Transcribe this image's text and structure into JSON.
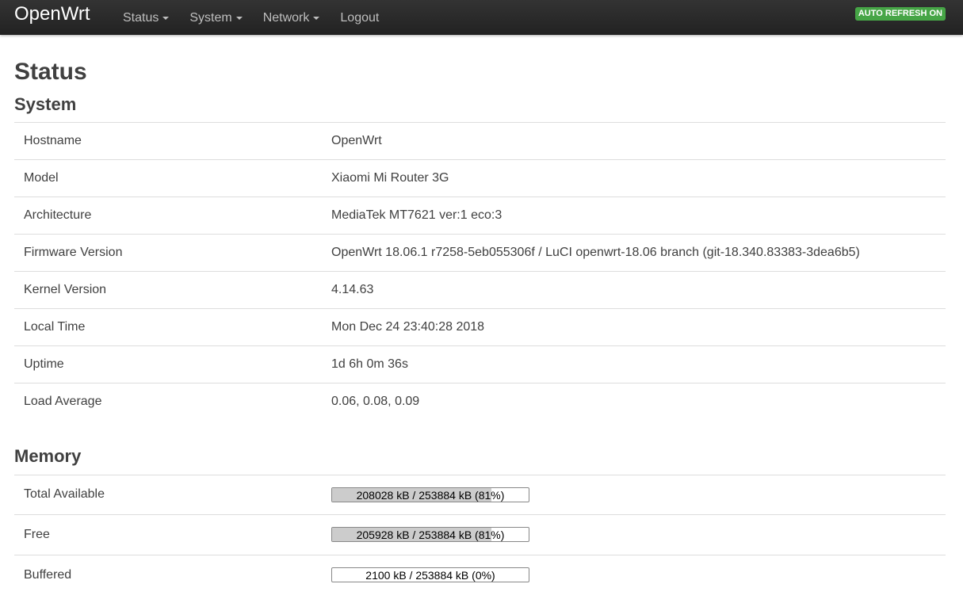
{
  "navbar": {
    "brand": "OpenWrt",
    "items": [
      {
        "label": "Status",
        "dropdown": true
      },
      {
        "label": "System",
        "dropdown": true
      },
      {
        "label": "Network",
        "dropdown": true
      },
      {
        "label": "Logout",
        "dropdown": false
      }
    ],
    "auto_refresh": "AUTO REFRESH ON"
  },
  "page": {
    "title": "Status"
  },
  "system": {
    "heading": "System",
    "rows": [
      {
        "label": "Hostname",
        "value": "OpenWrt"
      },
      {
        "label": "Model",
        "value": "Xiaomi Mi Router 3G"
      },
      {
        "label": "Architecture",
        "value": "MediaTek MT7621 ver:1 eco:3"
      },
      {
        "label": "Firmware Version",
        "value": "OpenWrt 18.06.1 r7258-5eb055306f / LuCI openwrt-18.06 branch (git-18.340.83383-3dea6b5)"
      },
      {
        "label": "Kernel Version",
        "value": "4.14.63"
      },
      {
        "label": "Local Time",
        "value": "Mon Dec 24 23:40:28 2018"
      },
      {
        "label": "Uptime",
        "value": "1d 6h 0m 36s"
      },
      {
        "label": "Load Average",
        "value": "0.06, 0.08, 0.09"
      }
    ]
  },
  "memory": {
    "heading": "Memory",
    "rows": [
      {
        "label": "Total Available",
        "text": "208028 kB / 253884 kB (81%)",
        "percent": 81
      },
      {
        "label": "Free",
        "text": "205928 kB / 253884 kB (81%)",
        "percent": 81
      },
      {
        "label": "Buffered",
        "text": "2100 kB / 253884 kB (0%)",
        "percent": 0
      }
    ]
  },
  "colors": {
    "navbar_bg": "#222222",
    "badge_green": "#46a546",
    "bar_fill": "#cccccc"
  }
}
